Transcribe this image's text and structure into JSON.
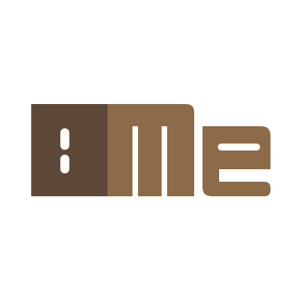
{
  "logo": {
    "text": "BMe",
    "colors": {
      "background": "#ffffff",
      "letter_b": "#5e4939",
      "letter_m": "#8d6b48",
      "letter_e": "#8d6b48",
      "letter_counter": "#ffffff"
    }
  }
}
